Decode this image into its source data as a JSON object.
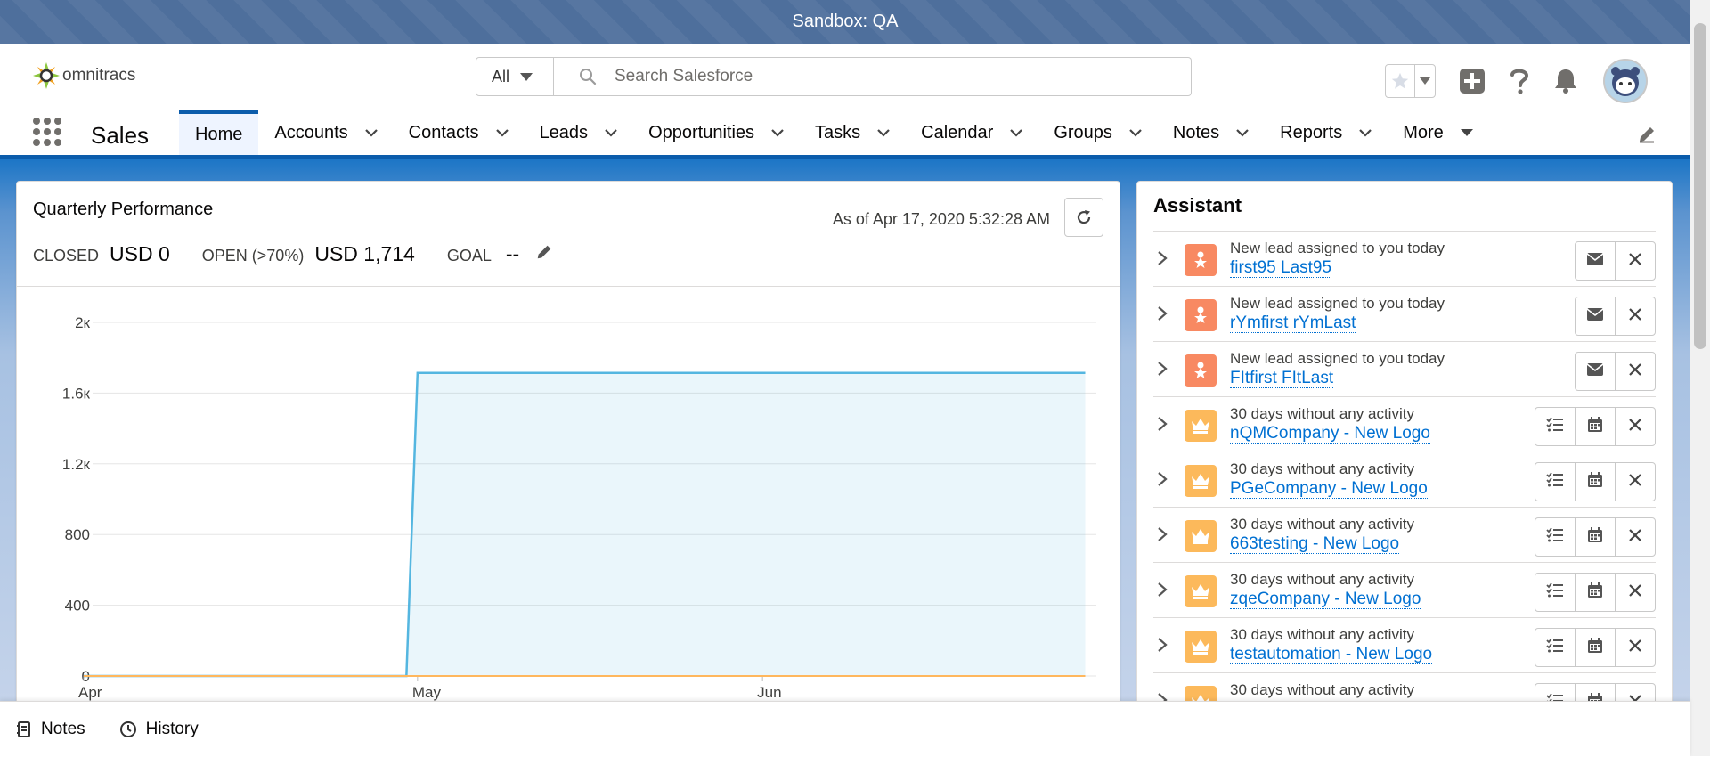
{
  "sandbox": {
    "label": "Sandbox: QA"
  },
  "header": {
    "logo_text": "omnitracs",
    "search": {
      "scope": "All",
      "placeholder": "Search Salesforce"
    }
  },
  "nav": {
    "app_name": "Sales",
    "tabs": [
      {
        "label": "Home",
        "active": true
      },
      {
        "label": "Accounts"
      },
      {
        "label": "Contacts"
      },
      {
        "label": "Leads"
      },
      {
        "label": "Opportunities"
      },
      {
        "label": "Tasks"
      },
      {
        "label": "Calendar"
      },
      {
        "label": "Groups"
      },
      {
        "label": "Notes"
      },
      {
        "label": "Reports"
      },
      {
        "label": "More"
      }
    ]
  },
  "quarterly": {
    "title": "Quarterly Performance",
    "as_of": "As of Apr 17, 2020 5:32:28 AM",
    "closed_label": "CLOSED",
    "closed_value": "USD 0",
    "open_label": "OPEN (>70%)",
    "open_value": "USD 1,714",
    "goal_label": "GOAL",
    "goal_value": "--"
  },
  "chart_data": {
    "type": "area",
    "y_ticks": [
      "0",
      "400",
      "800",
      "1.2к",
      "1.6к",
      "2к"
    ],
    "ylim": [
      0,
      2000
    ],
    "x_ticks": [
      "Apr",
      "May",
      "Jun"
    ],
    "series": [
      {
        "points": [
          [
            "Apr 1",
            0
          ],
          [
            "Apr 30",
            0
          ],
          [
            "May 1",
            1714
          ],
          [
            "Jun 30",
            1714
          ]
        ],
        "color": "#54b6e0"
      },
      {
        "points": [
          [
            "Apr 1",
            0
          ],
          [
            "Jun 30",
            0
          ]
        ],
        "color": "#ffb75d"
      }
    ],
    "grid": true
  },
  "assistant": {
    "title": "Assistant",
    "items": [
      {
        "type": "lead",
        "subtitle": "New lead assigned to you today",
        "link": "first95 Last95"
      },
      {
        "type": "lead",
        "subtitle": "New lead assigned to you today",
        "link": "rYmfirst rYmLast"
      },
      {
        "type": "lead",
        "subtitle": "New lead assigned to you today",
        "link": "FItfirst FItLast"
      },
      {
        "type": "opp",
        "subtitle": "30 days without any activity",
        "link": "nQMCompany - New Logo"
      },
      {
        "type": "opp",
        "subtitle": "30 days without any activity",
        "link": "PGeCompany - New Logo"
      },
      {
        "type": "opp",
        "subtitle": "30 days without any activity",
        "link": "663testing - New Logo"
      },
      {
        "type": "opp",
        "subtitle": "30 days without any activity",
        "link": "zqeCompany - New Logo"
      },
      {
        "type": "opp",
        "subtitle": "30 days without any activity",
        "link": "testautomation - New Logo"
      },
      {
        "type": "opp",
        "subtitle": "30 days without any activity",
        "link": ""
      }
    ]
  },
  "utility": {
    "notes_label": "Notes",
    "history_label": "History"
  }
}
